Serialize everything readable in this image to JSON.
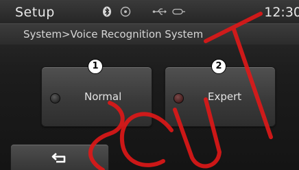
{
  "status_bar": {
    "title": "Setup",
    "clock": "12:30",
    "icons": [
      "bluetooth-icon",
      "disc-icon",
      "usb-icon",
      "aux-icon"
    ]
  },
  "breadcrumb": {
    "text": "System>Voice Recognition System"
  },
  "options": [
    {
      "label": "Normal",
      "badge": "1",
      "selected": false
    },
    {
      "label": "Expert",
      "badge": "2",
      "selected": true
    }
  ],
  "back_button": {
    "icon": "return-arrow-icon"
  },
  "watermark": {
    "text": "SCUT"
  },
  "colors": {
    "background": "#1c1c1c",
    "text": "#e4e4e4",
    "watermark": "#e01818",
    "selected_radio": "#7a4a4a"
  }
}
